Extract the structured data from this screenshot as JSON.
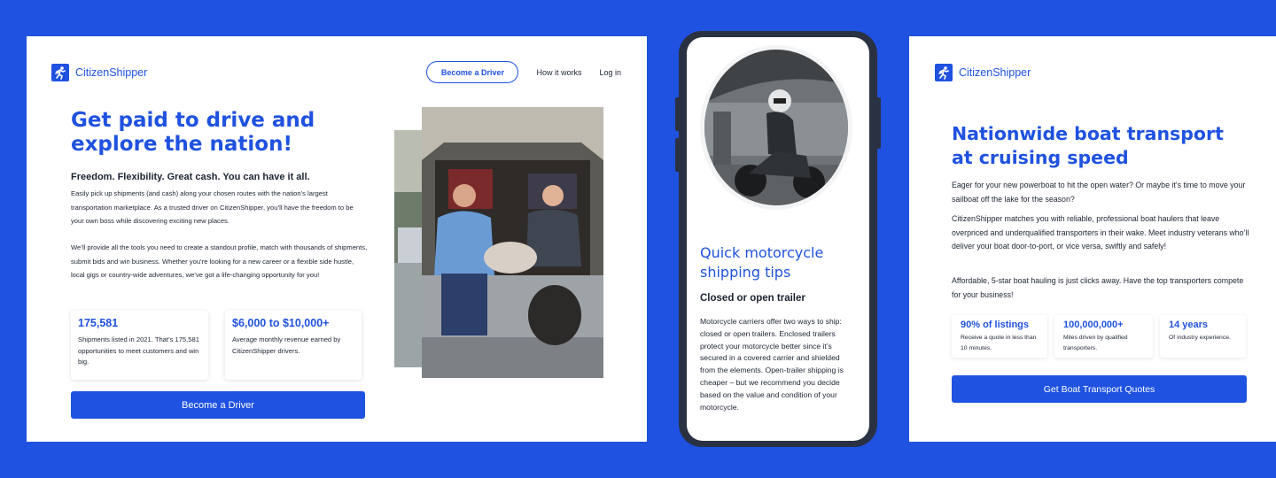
{
  "colors": {
    "background": "#1f52e0",
    "accent": "#1f52e0",
    "text": "#1d2433",
    "card": "#ffffff"
  },
  "driver_page": {
    "logo_text": "CitizenShipper",
    "nav": {
      "become_driver": "Become a Driver",
      "how_it_works": "How it works",
      "login": "Log in"
    },
    "title": "Get paid to drive and explore the nation!",
    "subtitle": "Freedom. Flexibility. Great cash. You can have it all.",
    "para1": "Easily pick up shipments (and cash) along your chosen routes with the nation’s largest transportation marketplace. As a trusted driver on CitizenShipper, you’ll have the freedom to be your own boss while discovering exciting new places.",
    "para2": "We’ll provide all the tools you need to create a standout profile, match with thousands of shipments, submit bids and win business. Whether you’re looking for a new career or a flexible side hustle, local gigs or country-wide adventures, we’ve got a life-changing opportunity for you!",
    "stats": [
      {
        "value": "175,581",
        "desc": "Shipments listed in 2021. That’s 175,581 opportunities to meet customers and win big."
      },
      {
        "value": "$6,000 to $10,000+",
        "desc": "Average monthly revenue earned by CitizenShipper drivers."
      }
    ],
    "cta": "Become a Driver"
  },
  "motorcycle_page": {
    "title": "Quick motorcycle shipping tips",
    "subtitle": "Closed or open trailer",
    "body": "Motorcycle carriers offer two ways to ship: closed or open trailers. Enclosed trailers protect your motorcycle better since it’s secured in a covered carrier and shielded from the elements. Open-trailer shipping is cheaper – but we recommend you decide based on the value and condition of your motorcycle."
  },
  "boat_page": {
    "logo_text": "CitizenShipper",
    "title": "Nationwide boat transport at cruising speed",
    "para1": "Eager for your new powerboat to hit the open water? Or maybe it’s time to move your sailboat off the lake for the season?",
    "para2": "CitizenShipper matches you with reliable, professional boat haulers that leave overpriced and underqualified transporters in their wake. Meet industry veterans who’ll deliver your boat door-to-port, or vice versa, swiftly and safely!",
    "para3": "Affordable, 5-star boat hauling is just clicks away. Have the top transporters compete for your business!",
    "stats": [
      {
        "value": "90% of listings",
        "desc": "Receive a quote in less than 10 minutes."
      },
      {
        "value": "100,000,000+",
        "desc": "Miles driven by qualified transporters."
      },
      {
        "value": "14 years",
        "desc": "Of industry experience."
      }
    ],
    "cta": "Get Boat Transport Quotes"
  }
}
